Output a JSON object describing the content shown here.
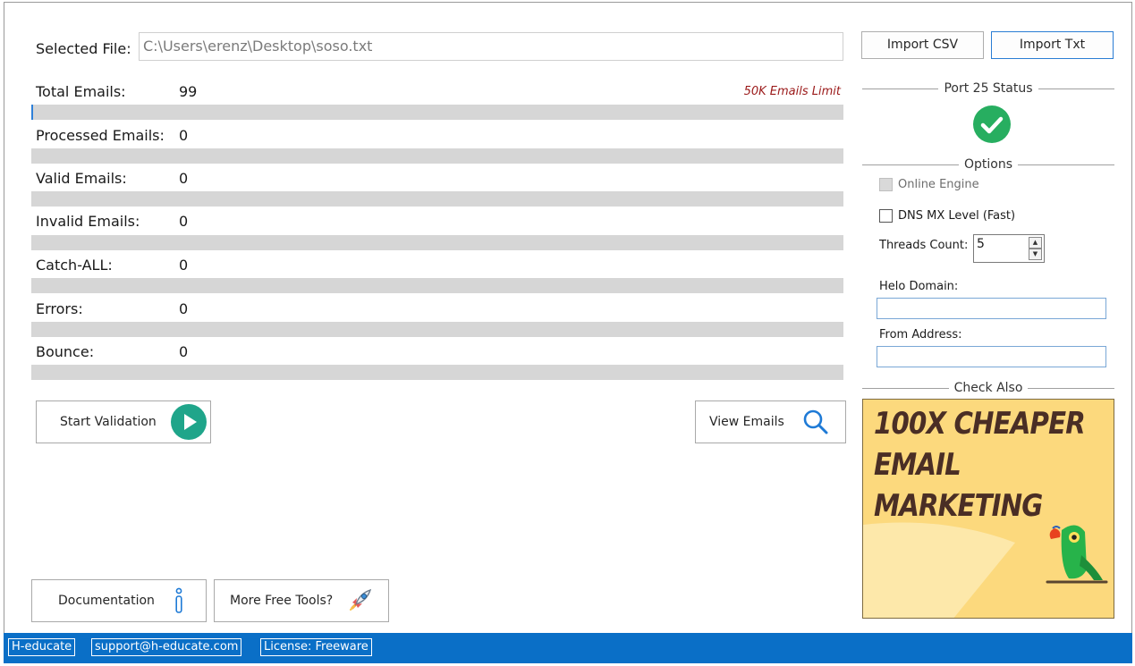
{
  "file": {
    "label": "Selected File:",
    "value": "C:\\Users\\erenz\\Desktop\\soso.txt"
  },
  "stats": {
    "limit_note": "50K Emails Limit",
    "rows": [
      {
        "label": "Total Emails:",
        "value": "99",
        "progress": 0.002
      },
      {
        "label": "Processed Emails:",
        "value": "0",
        "progress": 0
      },
      {
        "label": "Valid Emails:",
        "value": "0",
        "progress": 0
      },
      {
        "label": "Invalid Emails:",
        "value": "0",
        "progress": 0
      },
      {
        "label": "Catch-ALL:",
        "value": "0",
        "progress": 0
      },
      {
        "label": "Errors:",
        "value": "0",
        "progress": 0
      },
      {
        "label": "Bounce:",
        "value": "0",
        "progress": 0
      }
    ]
  },
  "actions": {
    "start_label": "Start Validation",
    "view_label": "View Emails",
    "documentation_label": "Documentation",
    "tools_label": "More Free Tools?"
  },
  "import": {
    "csv_label": "Import CSV",
    "txt_label": "Import Txt"
  },
  "port_status": {
    "title": "Port  25 Status",
    "status_color": "#27ae60"
  },
  "options": {
    "title": "Options",
    "online_engine": {
      "label": "Online Engine",
      "checked": false,
      "enabled": false
    },
    "dns_mx": {
      "label": "DNS MX Level (Fast)",
      "checked": false,
      "enabled": true
    },
    "threads_label": "Threads Count:",
    "threads_value": "5",
    "helo_label": "Helo Domain:",
    "helo_value": "",
    "from_label": "From Address:",
    "from_value": ""
  },
  "check_also": {
    "title": "Check Also",
    "ad_line1": "100X CHEAPER",
    "ad_line2": "EMAIL",
    "ad_line3": "MARKETING"
  },
  "status_bar": {
    "brand": "H-educate",
    "email": "support@h-educate.com",
    "license": "License: Freeware"
  },
  "colors": {
    "accent": "#0a6fc7",
    "play_button": "#1fa58a",
    "search_icon": "#1e7ad6",
    "limit_text": "#9b1a1a",
    "ad_background": "#fcd97d",
    "ad_text": "#4a2e25"
  }
}
